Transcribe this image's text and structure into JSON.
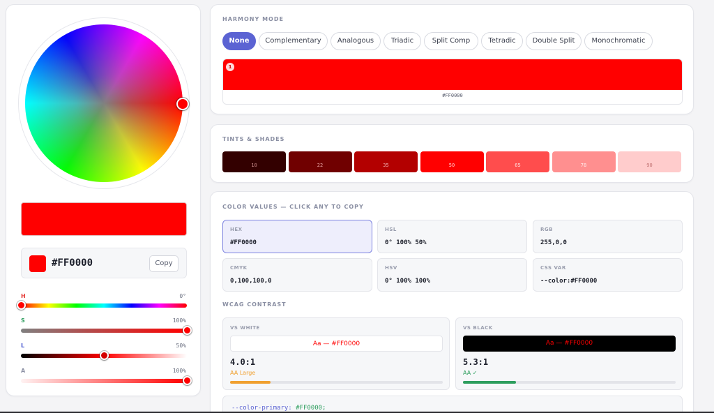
{
  "left": {
    "hex_value": "#FF0000",
    "copy_label": "Copy",
    "sliders": [
      {
        "label": "H",
        "value_text": "0°",
        "level": 0.0,
        "color": "#e53935"
      },
      {
        "label": "S",
        "value_text": "100%",
        "level": 1.0,
        "color": "#2e9e5e"
      },
      {
        "label": "L",
        "value_text": "50%",
        "level": 0.5,
        "color": "#4a5ad0"
      },
      {
        "label": "A",
        "value_text": "100%",
        "level": 1.0,
        "color": "#8a8fa3"
      }
    ],
    "current_color": "#FF0000"
  },
  "harmony": {
    "title": "HARMONY MODE",
    "modes": [
      "None",
      "Complementary",
      "Analogous",
      "Triadic",
      "Split Comp",
      "Tetradic",
      "Double Split",
      "Monochromatic"
    ],
    "active_mode": "None",
    "swatches": [
      {
        "index": "1",
        "hex": "#FF0000"
      }
    ]
  },
  "tints": {
    "title": "TINTS & SHADES",
    "items": [
      {
        "label": "10",
        "color": "#330000",
        "text_color": "#c88"
      },
      {
        "label": "22",
        "color": "#700000",
        "text_color": "#e8a0a0"
      },
      {
        "label": "35",
        "color": "#b30000",
        "text_color": "#f0b0b0"
      },
      {
        "label": "50",
        "color": "#ff0000",
        "text_color": "#ffd0d0"
      },
      {
        "label": "65",
        "color": "#ff4d4d",
        "text_color": "#ffe0e0"
      },
      {
        "label": "78",
        "color": "#ff8f8f",
        "text_color": "#fff0f0"
      },
      {
        "label": "90",
        "color": "#ffcccc",
        "text_color": "#c07070"
      }
    ]
  },
  "values": {
    "title": "COLOR VALUES — CLICK ANY TO COPY",
    "items": [
      {
        "label": "HEX",
        "value": "#FF0000"
      },
      {
        "label": "HSL",
        "value": "0° 100% 50%"
      },
      {
        "label": "RGB",
        "value": "255,0,0"
      },
      {
        "label": "CMYK",
        "value": "0,100,100,0"
      },
      {
        "label": "HSV",
        "value": "0° 100% 100%"
      },
      {
        "label": "CSS VAR",
        "value": "--color:#FF0000"
      }
    ],
    "selected": "HEX"
  },
  "wcag": {
    "title": "WCAG CONTRAST",
    "white": {
      "label": "VS WHITE",
      "sample": "Aa — #FF0000",
      "ratio": "4.0:1",
      "grade": "AA Large",
      "grade_color": "#f0a030",
      "level": 0.19
    },
    "black": {
      "label": "VS BLACK",
      "sample": "Aa — #FF0000",
      "ratio": "5.3:1",
      "grade": "AA ✓",
      "grade_color": "#2e9e5e",
      "level": 0.25
    }
  },
  "css_output": {
    "prop": "--color-primary:",
    "value": "#FF0000;"
  }
}
